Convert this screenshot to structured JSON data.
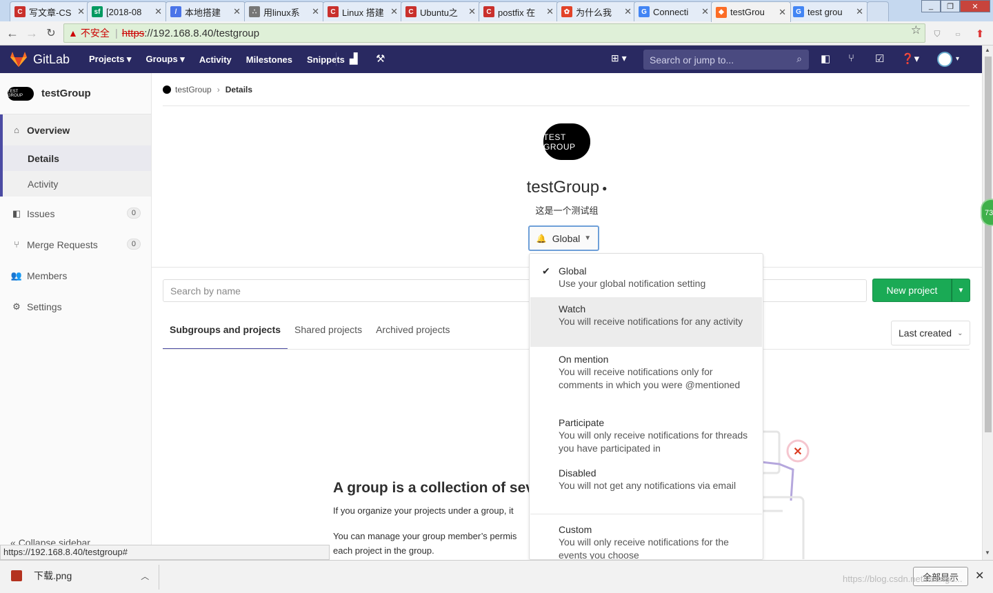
{
  "browser": {
    "tabs": [
      {
        "title": "写文章-CS",
        "fav_color": "#c9302c",
        "fav_glyph": "C"
      },
      {
        "title": "[2018-08",
        "fav_color": "#009a61",
        "fav_glyph": "sf"
      },
      {
        "title": "本地搭建",
        "fav_color": "#4a74e8",
        "fav_glyph": "/"
      },
      {
        "title": "用linux系",
        "fav_color": "#777777",
        "fav_glyph": "∴"
      },
      {
        "title": "Linux 搭建",
        "fav_color": "#c9302c",
        "fav_glyph": "C"
      },
      {
        "title": "Ubuntu之",
        "fav_color": "#c9302c",
        "fav_glyph": "C"
      },
      {
        "title": "postfix 在",
        "fav_color": "#c9302c",
        "fav_glyph": "C"
      },
      {
        "title": "为什么我",
        "fav_color": "#e24329",
        "fav_glyph": "✿"
      },
      {
        "title": "Connecti",
        "fav_color": "#4285f4",
        "fav_glyph": "G"
      },
      {
        "title": "testGrou",
        "fav_color": "#fc6d26",
        "fav_glyph": "◆"
      },
      {
        "title": "test grou",
        "fav_color": "#4285f4",
        "fav_glyph": "G"
      }
    ],
    "active_tab": 9,
    "address": {
      "insecure_label": "不安全",
      "scheme": "https",
      "rest": "://192.168.8.40/testgroup"
    },
    "status_url": "https://192.168.8.40/testgroup#",
    "download": {
      "filename": "下载.png",
      "show_all": "全部显示"
    },
    "watermark": "https://blog.csdn.net/kuangd..."
  },
  "gitlab": {
    "brand": "GitLab",
    "nav": {
      "projects": "Projects ▾",
      "groups": "Groups ▾",
      "activity": "Activity",
      "milestones": "Milestones",
      "snippets": "Snippets"
    },
    "search_placeholder": "Search or jump to...",
    "colors": {
      "navbar": "#292961",
      "accent": "#4b4ba3",
      "success": "#1aaa55"
    }
  },
  "sidebar": {
    "group_name": "testGroup",
    "group_avatar_text": "TEST GROUP",
    "overview": "Overview",
    "details": "Details",
    "activity": "Activity",
    "issues": {
      "label": "Issues",
      "count": "0"
    },
    "merge_requests": {
      "label": "Merge Requests",
      "count": "0"
    },
    "members": "Members",
    "settings": "Settings",
    "collapse": "Collapse sidebar"
  },
  "main": {
    "breadcrumb": {
      "group": "testGroup",
      "current": "Details"
    },
    "group_title": "testGroup",
    "group_avatar_text": "TEST GROUP",
    "group_description": "这是一个测试组",
    "notification_button": "Global",
    "search_placeholder": "Search by name",
    "new_project": "New project",
    "tabs": [
      "Subgroups and projects",
      "Shared projects",
      "Archived projects"
    ],
    "sort": "Last created",
    "empty_heading": "A group is a collection of seve",
    "empty_p1": "If you organize your projects under a group, it",
    "empty_p2a": "You can manage your group member’s permis",
    "empty_p2b": "each project in the group."
  },
  "notification_dropdown": [
    {
      "title": "Global",
      "desc": "Use your global notification setting",
      "checked": true
    },
    {
      "title": "Watch",
      "desc": "You will receive notifications for any activity",
      "checked": false
    },
    {
      "title": "On mention",
      "desc": "You will receive notifications only for comments in which you were @mentioned",
      "checked": false
    },
    {
      "title": "Participate",
      "desc": "You will only receive notifications for threads you have participated in",
      "checked": false
    },
    {
      "title": "Disabled",
      "desc": "You will not get any notifications via email",
      "checked": false
    },
    {
      "title": "Custom",
      "desc": "You will only receive notifications for the events you choose",
      "checked": false
    }
  ],
  "float_badge": "73"
}
